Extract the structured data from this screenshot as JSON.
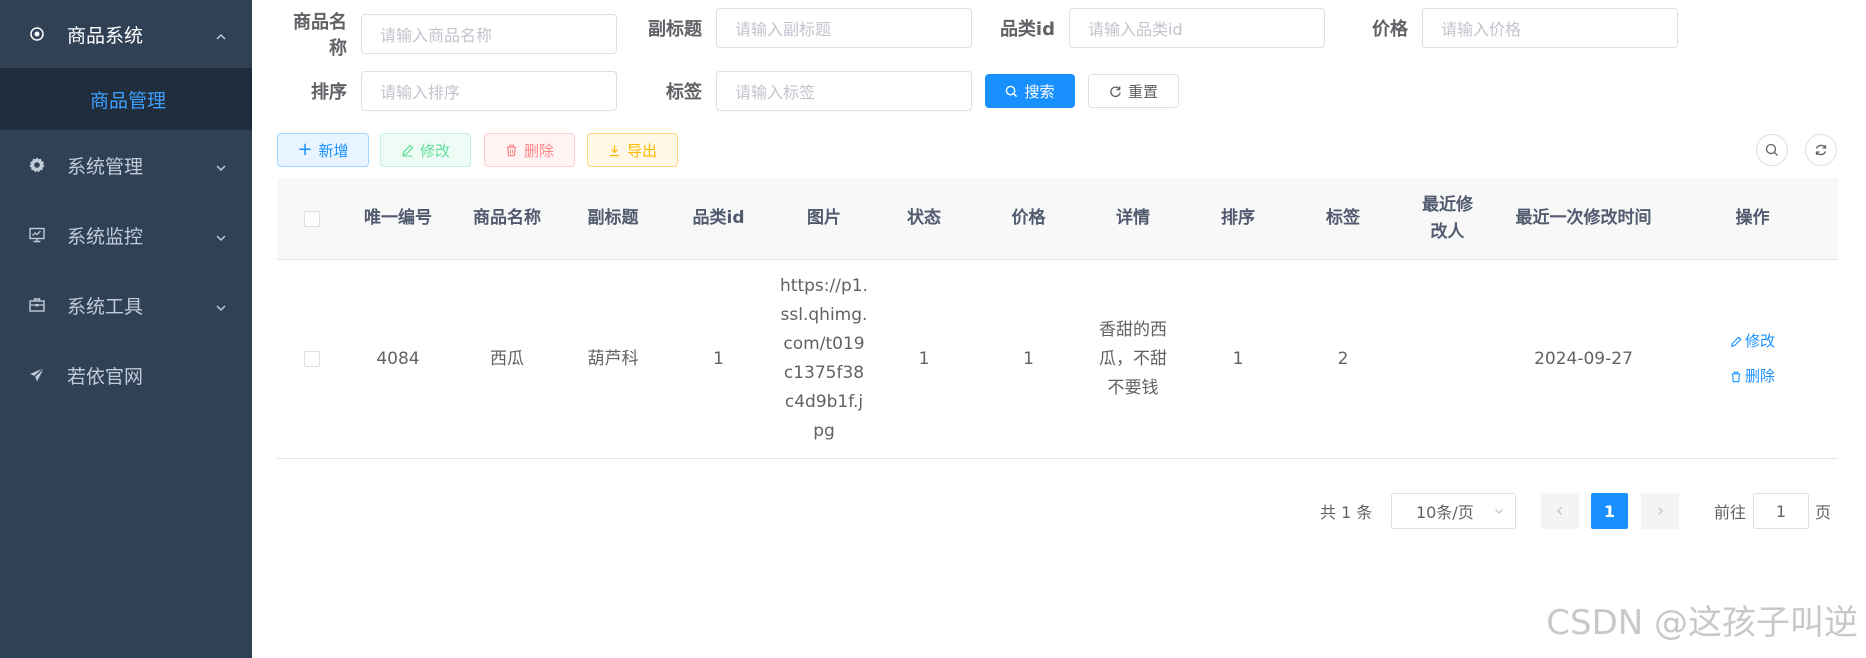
{
  "sidebar": {
    "items": [
      {
        "label": "商品系统",
        "icon": "radio-dot-icon",
        "open": true
      },
      {
        "label": "系统管理",
        "icon": "gear-icon"
      },
      {
        "label": "系统监控",
        "icon": "monitor-icon"
      },
      {
        "label": "系统工具",
        "icon": "toolbox-icon"
      },
      {
        "label": "若依官网",
        "icon": "paper-plane-icon"
      }
    ],
    "submenu": [
      {
        "label": "商品管理",
        "active": true
      }
    ]
  },
  "search": {
    "fields": [
      {
        "label": "商品名称",
        "placeholder": "请输入商品名称"
      },
      {
        "label": "副标题",
        "placeholder": "请输入副标题"
      },
      {
        "label": "品类id",
        "placeholder": "请输入品类id"
      },
      {
        "label": "价格",
        "placeholder": "请输入价格"
      },
      {
        "label": "排序",
        "placeholder": "请输入排序"
      },
      {
        "label": "标签",
        "placeholder": "请输入标签"
      }
    ],
    "search_label": "搜索",
    "reset_label": "重置"
  },
  "toolbar": {
    "add_label": "新增",
    "edit_label": "修改",
    "delete_label": "删除",
    "export_label": "导出"
  },
  "table": {
    "columns": [
      "唯一编号",
      "商品名称",
      "副标题",
      "品类id",
      "图片",
      "状态",
      "价格",
      "详情",
      "排序",
      "标签",
      "最近修改人",
      "最近一次修改时间",
      "操作"
    ],
    "rows": [
      {
        "id": "4084",
        "name": "西瓜",
        "subtitle": "葫芦科",
        "category_id": "1",
        "image_lines": [
          "https://p1.",
          "ssl.qhimg.",
          "com/t019",
          "c1375f38",
          "c4d9b1f.j",
          "pg"
        ],
        "status": "1",
        "price": "1",
        "detail_lines": [
          "香甜的西",
          "瓜，不甜",
          "不要钱"
        ],
        "sort": "1",
        "tag": "2",
        "modifier": "",
        "modified_time": "2024-09-27",
        "edit_label": "修改",
        "delete_label": "删除"
      }
    ]
  },
  "pagination": {
    "total_text": "共 1 条",
    "page_size": "10条/页",
    "current_page": "1",
    "goto_label": "前往",
    "goto_value": "1",
    "page_suffix": "页"
  },
  "watermark": "CSDN @这孩子叫逆",
  "colors": {
    "primary": "#1890ff",
    "sidebar_bg": "#304156",
    "submenu_bg": "#1f2d3d"
  }
}
